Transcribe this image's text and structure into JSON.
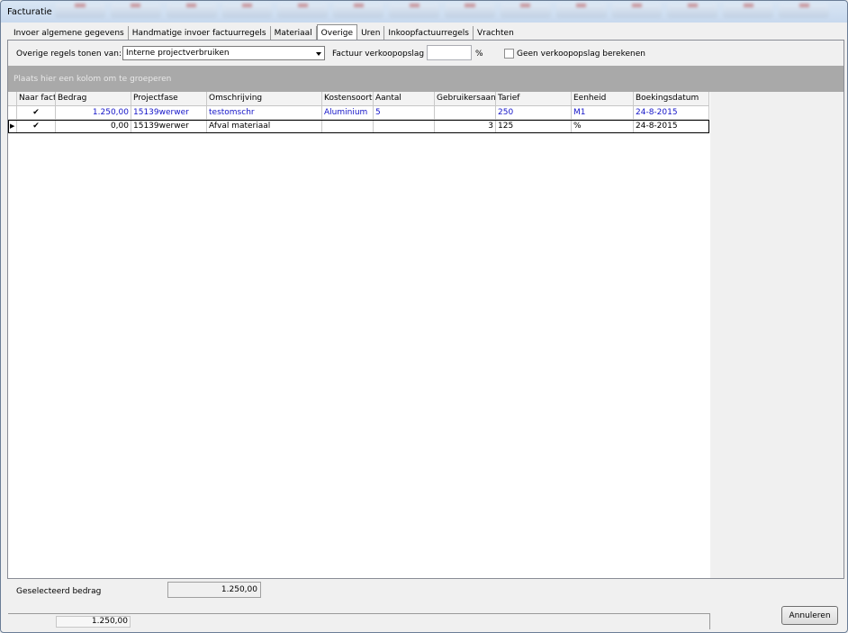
{
  "window": {
    "title": "Facturatie"
  },
  "tabs": [
    {
      "label": "Invoer algemene gegevens",
      "active": false
    },
    {
      "label": "Handmatige invoer factuurregels",
      "active": false
    },
    {
      "label": "Materiaal",
      "active": false
    },
    {
      "label": "Overige",
      "active": true
    },
    {
      "label": "Uren",
      "active": false
    },
    {
      "label": "Inkoopfactuurregels",
      "active": false
    },
    {
      "label": "Vrachten",
      "active": false
    }
  ],
  "filters": {
    "show_label": "Overige regels tonen van:",
    "show_value": "Interne projectverbruiken",
    "markup_label": "Factuur verkoopopslag",
    "markup_value": "",
    "percent_sign": "%",
    "no_markup_label": "Geen verkoopopslag berekenen",
    "no_markup_checked": false
  },
  "group_hint": "Plaats hier een kolom om te groeperen",
  "table": {
    "columns": [
      "Naar fact",
      "Bedrag",
      "Projectfase",
      "Omschrijving",
      "Kostensoort",
      "Aantal",
      "Gebruikersaantal",
      "Tarief",
      "Eenheid",
      "Boekingsdatum"
    ],
    "rows": [
      {
        "checked": "✔",
        "bedrag": "1.250,00",
        "projectfase": "15139werwer",
        "omschrijving": "testomschr",
        "kostensoort": "Aluminium",
        "aantal": "5",
        "gebruikersaantal": "",
        "tarief": "250",
        "eenheid": "M1",
        "boekingsdatum": "24-8-2015",
        "current": false
      },
      {
        "checked": "✔",
        "bedrag": "0,00",
        "projectfase": "15139werwer",
        "omschrijving": "Afval materiaal",
        "kostensoort": "",
        "aantal": "",
        "gebruikersaantal": "3",
        "tarief": "125",
        "eenheid": "%",
        "boekingsdatum": "24-8-2015",
        "current": true
      }
    ],
    "footer_sum": "1.250,00"
  },
  "selected": {
    "label": "Geselecteerd bedrag",
    "value": "1.250,00"
  },
  "buttons": {
    "cancel": "Annuleren"
  },
  "colors": {
    "selected_text": "#1414c8",
    "group_bar": "#a9a9a9"
  }
}
